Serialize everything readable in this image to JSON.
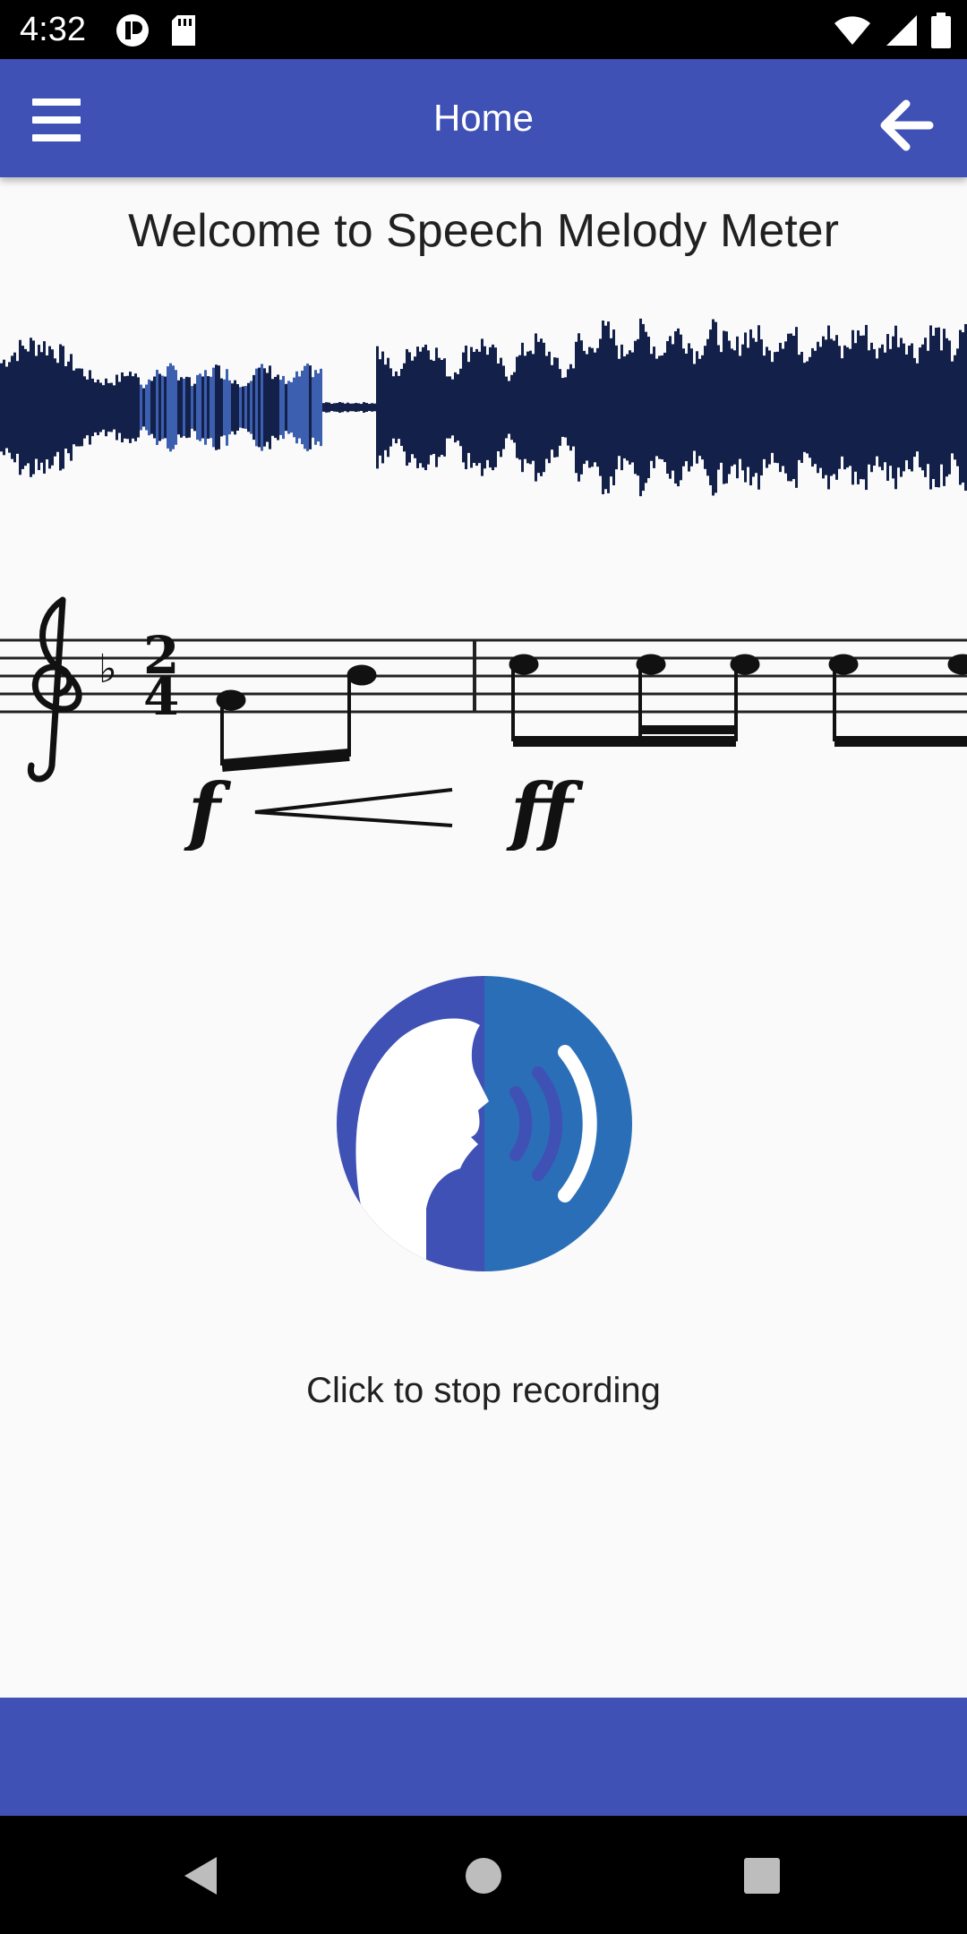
{
  "status_bar": {
    "time": "4:32",
    "left_icons": [
      "pinned-app-icon",
      "sd-card-icon"
    ],
    "right_icons": [
      "wifi-icon",
      "cell-signal-icon",
      "battery-icon"
    ]
  },
  "app_bar": {
    "title": "Home",
    "menu_icon": "hamburger-menu-icon",
    "back_icon": "arrow-left-icon",
    "color": "#3f51b5"
  },
  "main": {
    "welcome": "Welcome to Speech Melody Meter",
    "waveform_image": "audio-waveform-image",
    "sheet_music_image": "sheet-music-image",
    "sheet_music_dynamics": [
      "f",
      "ff"
    ],
    "mic_icon": "speaking-head-icon",
    "record_status": "Click to stop recording"
  },
  "nav_bar": {
    "buttons": [
      "back-triangle-icon",
      "home-circle-icon",
      "recents-square-icon"
    ]
  }
}
